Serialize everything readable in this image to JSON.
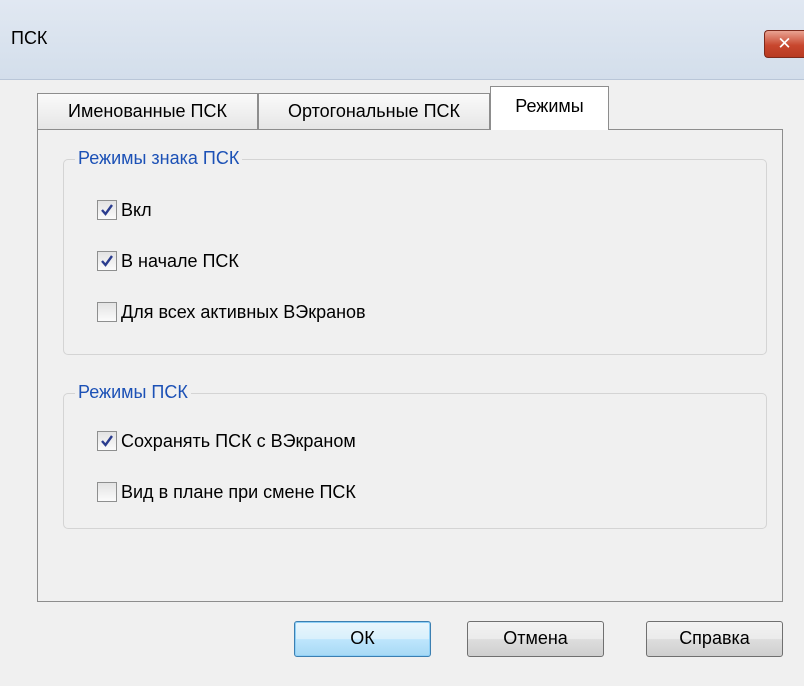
{
  "window": {
    "title": "ПСК",
    "close_symbol": "✕"
  },
  "tabs": [
    {
      "label": "Именованные ПСК",
      "active": false
    },
    {
      "label": "Ортогональные ПСК",
      "active": false
    },
    {
      "label": "Режимы",
      "active": true
    }
  ],
  "group_icon_modes": {
    "legend": "Режимы знака ПСК",
    "options": [
      {
        "label": "Вкл",
        "checked": true
      },
      {
        "label": "В начале ПСК",
        "checked": true
      },
      {
        "label": "Для всех активных ВЭкранов",
        "checked": false
      }
    ]
  },
  "group_ucs_modes": {
    "legend": "Режимы ПСК",
    "options": [
      {
        "label": "Сохранять ПСК с ВЭкраном",
        "checked": true
      },
      {
        "label": "Вид в плане при смене ПСК",
        "checked": false
      }
    ]
  },
  "buttons": {
    "ok": "ОК",
    "cancel": "Отмена",
    "help": "Справка"
  },
  "colors": {
    "legend": "#1c51b6",
    "checkmark": "#2b3d8f"
  }
}
